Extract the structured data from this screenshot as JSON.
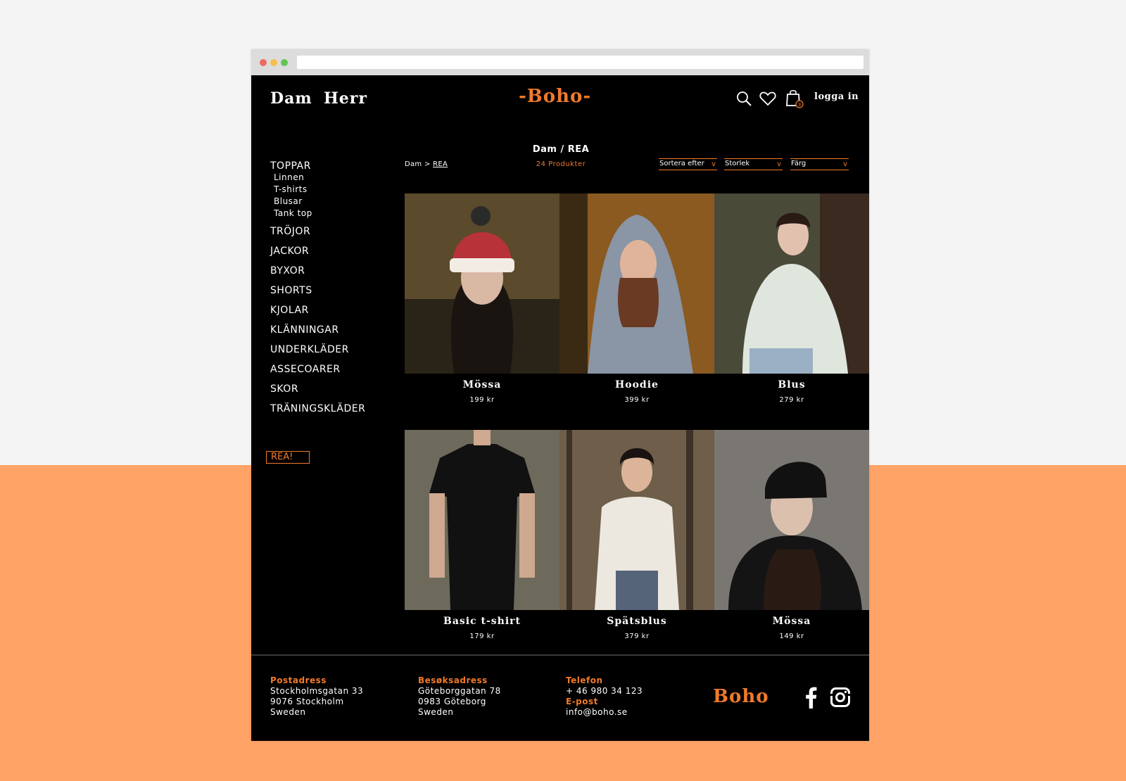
{
  "header": {
    "nav": [
      "Dam",
      "Herr"
    ],
    "logo": "-Boho-",
    "login": "logga in",
    "cart_count": "3",
    "accent": "#f07a2a"
  },
  "sidebar": {
    "categories": [
      {
        "label": "TOPPAR",
        "sub": [
          "Linnen",
          "T-shirts",
          "Blusar",
          "Tank top"
        ]
      },
      {
        "label": "TRÖJOR"
      },
      {
        "label": "JACKOR"
      },
      {
        "label": "BYXOR"
      },
      {
        "label": "SHORTS"
      },
      {
        "label": "KJOLAR"
      },
      {
        "label": "KLÄNNINGAR"
      },
      {
        "label": "UNDERKLÄDER"
      },
      {
        "label": "ASSECOARER"
      },
      {
        "label": "SKOR"
      },
      {
        "label": "TRÄNINGSKLÄDER"
      }
    ],
    "sale_button": "REA!"
  },
  "listing": {
    "heading": "Dam / REA",
    "breadcrumb_root": "Dam",
    "breadcrumb_sep": ">",
    "breadcrumb_current": "REA",
    "count": "24 Produkter",
    "filters": {
      "sort": "Sortera efter",
      "size": "Storlek",
      "color": "Färg",
      "chevron": "v"
    }
  },
  "products": [
    {
      "name": "Mössa",
      "price": "199 kr",
      "tone": [
        "#5b4a2c",
        "#2a2418"
      ]
    },
    {
      "name": "Hoodie",
      "price": "399 kr",
      "tone": [
        "#8a5a20",
        "#3a2a14"
      ]
    },
    {
      "name": "Blus",
      "price": "279 kr",
      "tone": [
        "#4a4a38",
        "#2a241c"
      ]
    },
    {
      "name": "Basic t-shirt",
      "price": "179 kr",
      "tone": [
        "#6d6a5c",
        "#3a382e"
      ]
    },
    {
      "name": "Spätsblus",
      "price": "379 kr",
      "tone": [
        "#6e5e4a",
        "#3c3228"
      ]
    },
    {
      "name": "Mössa",
      "price": "149 kr",
      "tone": [
        "#7a7672",
        "#3a3634"
      ]
    }
  ],
  "footer": {
    "postal": {
      "label": "Postadress",
      "lines": [
        "Stockholmsgatan 33",
        "9076 Stockholm",
        "Sweden"
      ]
    },
    "visit": {
      "label": "Besøksadress",
      "lines": [
        "Göteborggatan 78",
        "0983 Göteborg",
        "Sweden"
      ]
    },
    "phone_label": "Telefon",
    "phone": "+ 46 980 34 123",
    "email_label": "E-post",
    "email": "info@boho.se",
    "logo": "Boho"
  }
}
